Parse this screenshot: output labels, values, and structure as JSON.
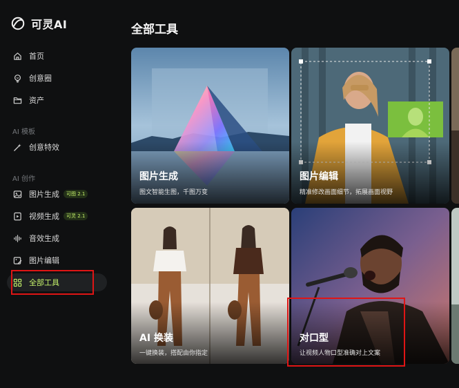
{
  "app": {
    "brand": "可灵AI"
  },
  "sidebar": {
    "main": [
      {
        "label": "首页",
        "icon": "home-icon"
      },
      {
        "label": "创意圈",
        "icon": "bulb-icon"
      },
      {
        "label": "资产",
        "icon": "folder-icon"
      }
    ],
    "section_templates": "AI 模板",
    "templates": [
      {
        "label": "创意特效",
        "icon": "magic-icon"
      }
    ],
    "section_create": "AI 创作",
    "create": [
      {
        "label": "图片生成",
        "badge": "可图 2.1",
        "icon": "image-icon"
      },
      {
        "label": "视频生成",
        "badge": "可灵 2.1",
        "icon": "video-icon"
      },
      {
        "label": "音效生成",
        "badge": "",
        "icon": "audio-wave-icon"
      },
      {
        "label": "图片编辑",
        "badge": "",
        "icon": "image-edit-icon"
      },
      {
        "label": "全部工具",
        "badge": "",
        "icon": "grid-icon",
        "active": true
      }
    ]
  },
  "main": {
    "title": "全部工具",
    "cards": [
      {
        "title": "图片生成",
        "desc": "图文智能生图，千图万变"
      },
      {
        "title": "图片编辑",
        "desc": "精准修改画面细节，拓展画面视野"
      },
      {
        "title": "AI 换装",
        "desc": "一键换装，搭配由你指定"
      },
      {
        "title": "对口型",
        "desc": "让视频人物口型准确对上文案"
      }
    ]
  },
  "colors": {
    "accent": "#c6f36b",
    "background": "#0f1011",
    "highlight": "#e01515"
  }
}
